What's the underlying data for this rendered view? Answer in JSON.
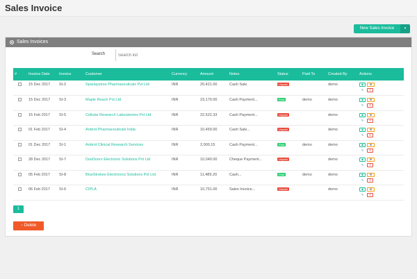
{
  "header": {
    "title": "Sales Invoice"
  },
  "toolbar": {
    "new_label": "New Sales Invoice",
    "caret": "▾"
  },
  "panel": {
    "title": "Sales Invoices"
  },
  "search": {
    "label": "Search",
    "placeholder": "Search list"
  },
  "table": {
    "columns": [
      "#",
      "Invoice Date",
      "Invoice",
      "Customer",
      "Currency",
      "Amount",
      "Notes",
      "Status",
      "Paid To",
      "Created By",
      "Actions"
    ],
    "rows": [
      {
        "date": "15 Dec 2017",
        "invoice": "SI-2",
        "customer": "Sparlaystree Pharmaceuticals Pvt Ltd",
        "currency": "INR",
        "amount": "20,421.00",
        "notes": "Cash Sale",
        "status": "Unpaid",
        "status_type": "unpaid",
        "paid_to": "",
        "created_by": "demo"
      },
      {
        "date": "15 Dec 2017",
        "invoice": "SI-3",
        "customer": "Maple Reach Pvt Ltd",
        "currency": "INR",
        "amount": "23,170.00",
        "notes": "Cash Payment...",
        "status": "Paid",
        "status_type": "paid",
        "paid_to": "demo",
        "created_by": "demo"
      },
      {
        "date": "15 Feb 2017",
        "invoice": "SI-5",
        "customer": "Cellular Research Laboratories Pvt Ltd",
        "currency": "INR",
        "amount": "22,522.33",
        "notes": "Cash Payment...",
        "status": "Unpaid",
        "status_type": "unpaid",
        "paid_to": "",
        "created_by": "demo"
      },
      {
        "date": "01 Feb 2017",
        "invoice": "SI-4",
        "customer": "Ardent Pharmaceuticals India",
        "currency": "INR",
        "amount": "10,459.00",
        "notes": "Cash Sale...",
        "status": "Unpaid",
        "status_type": "unpaid",
        "paid_to": "",
        "created_by": "demo"
      },
      {
        "date": "01 Dec 2017",
        "invoice": "SI-1",
        "customer": "Ardent Clinical Research Services",
        "currency": "INR",
        "amount": "2,000.15",
        "notes": "Cash Payment...",
        "status": "Paid",
        "status_type": "paid",
        "paid_to": "demo",
        "created_by": "demo"
      },
      {
        "date": "28 Dec 2017",
        "invoice": "SI-7",
        "customer": "DuoDoors Electronic Solutions Pvt Ltd",
        "currency": "INR",
        "amount": "10,040.00",
        "notes": "Cheque Payment...",
        "status": "Unpaid",
        "status_type": "unpaid",
        "paid_to": "",
        "created_by": "demo"
      },
      {
        "date": "05 Feb 2017",
        "invoice": "SI-8",
        "customer": "BlueStrokes Electronics Solutions Pvt Ltd",
        "currency": "INR",
        "amount": "11,489.20",
        "notes": "Cash...",
        "status": "Paid",
        "status_type": "paid",
        "paid_to": "demo",
        "created_by": "demo"
      },
      {
        "date": "06 Feb 2017",
        "invoice": "SI-6",
        "customer": "CIPLA",
        "currency": "INR",
        "amount": "10,751.00",
        "notes": "Sales Invoice...",
        "status": "Unpaid",
        "status_type": "unpaid",
        "paid_to": "",
        "created_by": "demo"
      }
    ]
  },
  "pagination": {
    "current": "1"
  },
  "footer": {
    "delete_label": "− Delete"
  },
  "icons": {
    "panel": "eye-icon",
    "view": "eye-icon",
    "mail": "envelope-icon",
    "edit": "pencil-icon",
    "delete": "close-icon"
  },
  "colors": {
    "accent": "#1abc9c",
    "danger": "#e74c3c",
    "success": "#2ecc71",
    "delete_btn": "#f05a28",
    "panel_head": "#7f7f7f"
  }
}
